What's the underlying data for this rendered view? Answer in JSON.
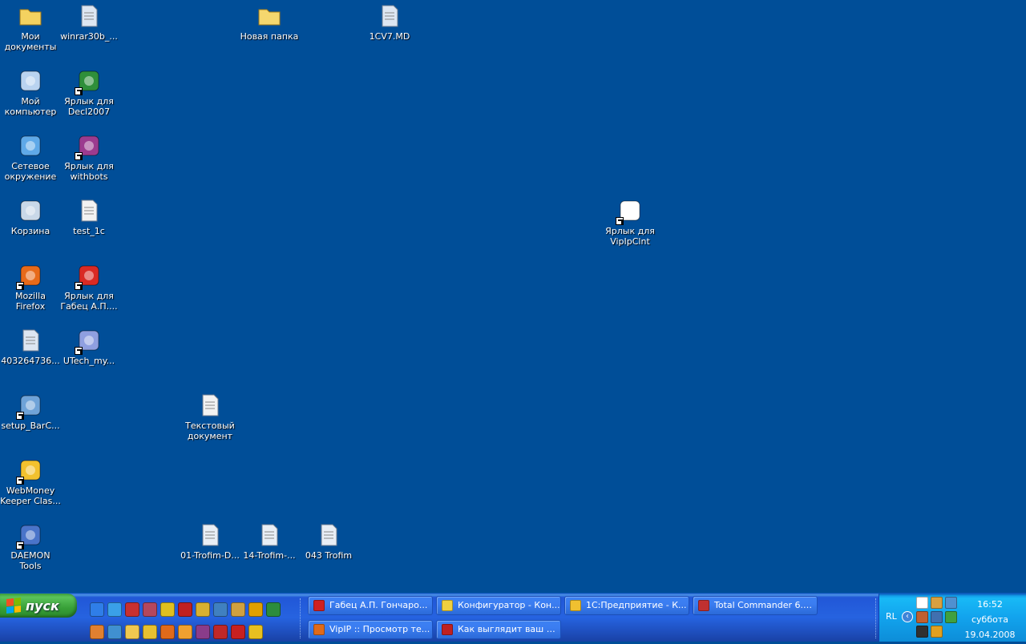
{
  "desktop": {
    "icons": [
      {
        "label": "Мои документы",
        "icon": "my-documents-icon",
        "color": "#f4d260"
      },
      {
        "label": "winrar30b_...",
        "icon": "archive-file-icon",
        "color": "#dde6f2"
      },
      {
        "label": "Новая папка",
        "icon": "folder-icon",
        "color": "#f5d76e"
      },
      {
        "label": "1CV7.MD",
        "icon": "document-file-icon",
        "color": "#dde6f2"
      },
      {
        "label": "Мой компьютер",
        "icon": "my-computer-icon",
        "color": "#b9d3f0"
      },
      {
        "label": "Ярлык для Decl2007",
        "icon": "decl-icon",
        "color": "#2f8f3a"
      },
      {
        "label": "Сетевое окружение",
        "icon": "network-icon",
        "color": "#5fa9e8"
      },
      {
        "label": "Ярлык для withbots",
        "icon": "winrar-icon",
        "color": "#9b3b8f"
      },
      {
        "label": "Корзина",
        "icon": "recycle-bin-icon",
        "color": "#c9d8e8"
      },
      {
        "label": "test_1c",
        "icon": "text-file-icon",
        "color": "#f2f2f2"
      },
      {
        "label": "Ярлык для VipIpClnt",
        "icon": "vipip-icon",
        "color": "#ffffff"
      },
      {
        "label": "Mozilla Firefox",
        "icon": "firefox-icon",
        "color": "#e76a1a"
      },
      {
        "label": "Ярлык для Габец А.П....",
        "icon": "pdf-icon",
        "color": "#d92a24"
      },
      {
        "label": "403264736...",
        "icon": "archive-file-icon",
        "color": "#dde6f2"
      },
      {
        "label": "UTech_my...",
        "icon": "utech-icon",
        "color": "#8f9fe0"
      },
      {
        "label": "setup_BarC...",
        "icon": "setup-icon",
        "color": "#6fa3d8"
      },
      {
        "label": "Текстовый документ",
        "icon": "text-file-icon",
        "color": "#f2f2f2"
      },
      {
        "label": "WebMoney Keeper Clas...",
        "icon": "webmoney-icon",
        "color": "#f2c12e"
      },
      {
        "label": "DAEMON Tools",
        "icon": "daemon-tools-icon",
        "color": "#4a74c9"
      },
      {
        "label": "01-Trofim-D...",
        "icon": "audio-file-icon",
        "color": "#e8eef5"
      },
      {
        "label": "14-Trofim-...",
        "icon": "audio-file-icon",
        "color": "#e8eef5"
      },
      {
        "label": "043 Trofim",
        "icon": "audio-file-icon",
        "color": "#e8eef5"
      }
    ]
  },
  "taskbar": {
    "start_label": "пуск",
    "quicklaunch_top": [
      {
        "icon": "ie-icon",
        "color": "#2f7ee8"
      },
      {
        "icon": "ie-alt-icon",
        "color": "#3aa0e8"
      },
      {
        "icon": "save-disk-icon",
        "color": "#c83030"
      },
      {
        "icon": "winrar-quick-icon",
        "color": "#b5475d"
      },
      {
        "icon": "pen-icon",
        "color": "#e0c020"
      },
      {
        "icon": "opera-icon",
        "color": "#c02020"
      },
      {
        "icon": "bug-icon",
        "color": "#d8b030"
      },
      {
        "icon": "monitor-icon",
        "color": "#4080c0"
      },
      {
        "icon": "tools-icon",
        "color": "#d0a040"
      },
      {
        "icon": "media-player-icon",
        "color": "#e0a000"
      },
      {
        "icon": "kaspersky-icon",
        "color": "#2c8c3c"
      }
    ],
    "quicklaunch_bottom": [
      {
        "icon": "app-icon",
        "color": "#e08030"
      },
      {
        "icon": "messenger-icon",
        "color": "#4090d0"
      },
      {
        "icon": "folder-quick-icon",
        "color": "#f0c850"
      },
      {
        "icon": "1c-icon",
        "color": "#e8c030"
      },
      {
        "icon": "firefox-quick-icon",
        "color": "#e06a1a"
      },
      {
        "icon": "globe-icon",
        "color": "#f0a030"
      },
      {
        "icon": "winrar-quick-2-icon",
        "color": "#8a3c8a"
      },
      {
        "icon": "nero-icon",
        "color": "#c02828"
      },
      {
        "icon": "acrobat-icon",
        "color": "#c82020"
      },
      {
        "icon": "warning-icon",
        "color": "#e8c020"
      }
    ],
    "tasks": [
      {
        "label": "Габец А.П. Гончаро...",
        "icon": "pdf-task-icon",
        "color": "#d02020"
      },
      {
        "label": "Конфигуратор - Кон...",
        "icon": "configurator-task-icon",
        "color": "#f0d040"
      },
      {
        "label": "1С:Предприятие - К...",
        "icon": "1c-task-icon",
        "color": "#f0c030"
      },
      {
        "label": "Total Commander 6.5...",
        "icon": "total-commander-task-icon",
        "color": "#c03030"
      },
      {
        "label": "VipIP :: Просмотр те...",
        "icon": "firefox-task-icon",
        "color": "#e06a1a"
      },
      {
        "label": "Как выглядит ваш р...",
        "icon": "opera-task-icon",
        "color": "#c02020"
      }
    ],
    "tray": {
      "language": "RL",
      "chevron": "‹",
      "icons": [
        {
          "icon": "vipip-tray-icon",
          "color": "#ffffff"
        },
        {
          "icon": "tools-tray-icon",
          "color": "#d8a040"
        },
        {
          "icon": "network-tray-icon",
          "color": "#5090d0"
        },
        {
          "icon": "app-tray-icon",
          "color": "#c06030"
        },
        {
          "icon": "computer-tray-icon",
          "color": "#4070b0"
        },
        {
          "icon": "wifi-tray-icon",
          "color": "#40a040"
        },
        {
          "icon": "bug-tray-icon",
          "color": "#303030"
        },
        {
          "icon": "pencil-tray-icon",
          "color": "#e0a020"
        }
      ],
      "time": "16:52",
      "day": "суббота",
      "date": "19.04.2008"
    }
  }
}
